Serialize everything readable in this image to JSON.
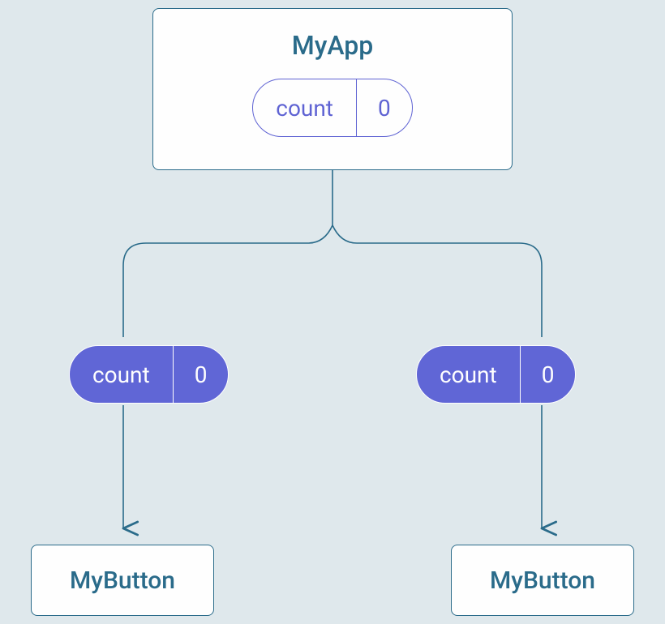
{
  "diagram": {
    "parent": {
      "title": "MyApp",
      "state": {
        "label": "count",
        "value": "0"
      }
    },
    "props": {
      "left": {
        "label": "count",
        "value": "0"
      },
      "right": {
        "label": "count",
        "value": "0"
      }
    },
    "children": {
      "left": "MyButton",
      "right": "MyButton"
    }
  }
}
